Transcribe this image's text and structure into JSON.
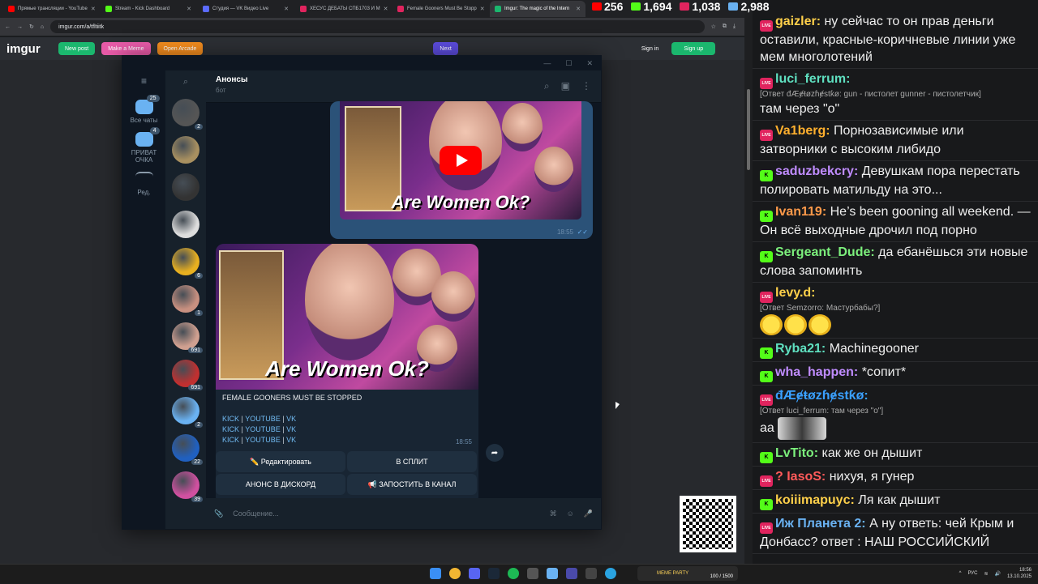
{
  "browser": {
    "tabs": [
      {
        "label": "Прямые трансляции - YouTube",
        "color": "#ff0000"
      },
      {
        "label": "Stream - Kick Dashboard",
        "color": "#53fc18"
      },
      {
        "label": "Студия — VK Видео Live",
        "color": "#5b6bff"
      },
      {
        "label": "ХЕСУС ДЕБАТЫ СПБ1703 И М",
        "color": "#e0245e"
      },
      {
        "label": "Female Gooners Must Be Stopp",
        "color": "#e0245e"
      },
      {
        "label": "Imgur: The magic of the Intern",
        "color": "#1bb76e"
      }
    ],
    "url": "imgur.com/a/tfltiitk"
  },
  "imgur": {
    "logo": "imgur",
    "new_post": "New post",
    "make_meme": "Make a Meme",
    "open_arcade": "Open Arcade",
    "next": "Next",
    "sign_in": "Sign in",
    "sign_up": "Sign up"
  },
  "telegram": {
    "rail": [
      {
        "label": "Все чаты",
        "badge": "25"
      },
      {
        "label": "ПРИВАТ ОЧКА",
        "badge": "4"
      },
      {
        "label": "Ред.",
        "badge": ""
      }
    ],
    "chat_counts": [
      "2",
      "",
      "",
      "",
      "6",
      "1",
      "691",
      "691",
      "2",
      "22",
      "39"
    ],
    "chat_name": "Анонсы",
    "chat_status": "бот",
    "out_time": "18:55",
    "thumb_caption": "Are Women Ok?",
    "msg_title": "FEMALE GOONERS MUST BE STOPPED",
    "links_row": [
      "KICK",
      "YOUTUBE",
      "VK"
    ],
    "in_time": "18:55",
    "buttons": [
      "✏️ Редактировать",
      "В СПЛИТ",
      "АНОНС В ДИСКОРД",
      "📢 ЗАПОСТИТЬ В КАНАЛ"
    ],
    "input_placeholder": "Сообщение..."
  },
  "stream": {
    "stats": [
      {
        "value": "256",
        "color": "#ff0000"
      },
      {
        "value": "1,694",
        "color": "#53fc18"
      },
      {
        "value": "1,038",
        "color": "#e0245e"
      },
      {
        "value": "2,988",
        "color": "#6ab2f2"
      }
    ],
    "messages": [
      {
        "platform": "live",
        "user": "gaizler:",
        "color": "#ffd04a",
        "text": "ну сейчас то он прав деньги оставили, красные-коричневые линии уже мем многолотений"
      },
      {
        "platform": "live",
        "user": "luci_ferrum:",
        "color": "#5fe0c0",
        "reply": "[Ответ đÆɇŧøzɦɇstƙø: gun - пистолет gunner - пистолетчик]",
        "text": "там через \"о\""
      },
      {
        "platform": "live",
        "user": "Va1berg:",
        "color": "#ffb02e",
        "text": "Порнозависимые или затворники с высоким либидо"
      },
      {
        "platform": "k",
        "user": "saduzbekcry:",
        "color": "#c08cff",
        "text": "Девушкам пора перестать полировать матильду на это..."
      },
      {
        "platform": "k",
        "user": "Ivan119:",
        "color": "#ff9a4a",
        "text": "He’s been gooning all weekend. — Он всё выходные дрочил под порно"
      },
      {
        "platform": "k",
        "user": "Sergeant_Dude:",
        "color": "#7cf07c",
        "text": "да ебанёшься эти новые слова запоминть"
      },
      {
        "platform": "live",
        "user": "levy.d:",
        "color": "#ffd04a",
        "reply": "[Ответ Semzorro: Мастурбабы?]",
        "emotes": 3
      },
      {
        "platform": "k",
        "user": "Ryba21:",
        "color": "#5fe0c0",
        "text": "Machinegooner"
      },
      {
        "platform": "k",
        "user": "wha_happen:",
        "color": "#c08cff",
        "text": "*сопит*"
      },
      {
        "platform": "live",
        "user": "đÆɇŧøzɦɇstƙø:",
        "color": "#3aa0ff",
        "reply": "[Ответ luci_ferrum: там через \"о\"]",
        "text": "аа",
        "dog": true
      },
      {
        "platform": "k",
        "user": "LvTito:",
        "color": "#7cf07c",
        "text": "как же он дышит"
      },
      {
        "platform": "live",
        "user": "? IasoS:",
        "color": "#ff5a5a",
        "text": "нихуя, я гунер"
      },
      {
        "platform": "k",
        "user": "koiiimapuyc:",
        "color": "#ffd04a",
        "text": "Ля как дышит"
      },
      {
        "platform": "live",
        "user": "Иж Планета 2:",
        "color": "#6ab2f2",
        "text": "А ну ответь: чей Крым и Донбасс? ответ : НАШ РОССИЙСКИЙ"
      }
    ]
  },
  "taskbar": {
    "party_label": "MEME PARTY",
    "party_progress": "100 / 1500",
    "lang": "РУС",
    "time": "18:56",
    "date": "13.10.2025"
  }
}
